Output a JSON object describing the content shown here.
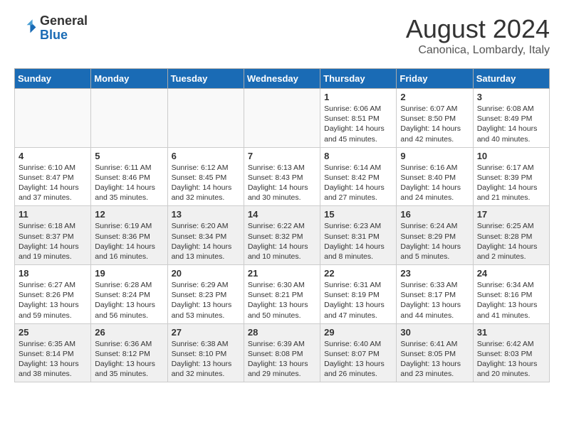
{
  "header": {
    "logo_line1": "General",
    "logo_line2": "Blue",
    "month": "August 2024",
    "location": "Canonica, Lombardy, Italy"
  },
  "weekdays": [
    "Sunday",
    "Monday",
    "Tuesday",
    "Wednesday",
    "Thursday",
    "Friday",
    "Saturday"
  ],
  "weeks": [
    [
      {
        "day": "",
        "empty": true
      },
      {
        "day": "",
        "empty": true
      },
      {
        "day": "",
        "empty": true
      },
      {
        "day": "",
        "empty": true
      },
      {
        "day": "1",
        "lines": [
          "Sunrise: 6:06 AM",
          "Sunset: 8:51 PM",
          "Daylight: 14 hours",
          "and 45 minutes."
        ]
      },
      {
        "day": "2",
        "lines": [
          "Sunrise: 6:07 AM",
          "Sunset: 8:50 PM",
          "Daylight: 14 hours",
          "and 42 minutes."
        ]
      },
      {
        "day": "3",
        "lines": [
          "Sunrise: 6:08 AM",
          "Sunset: 8:49 PM",
          "Daylight: 14 hours",
          "and 40 minutes."
        ]
      }
    ],
    [
      {
        "day": "4",
        "lines": [
          "Sunrise: 6:10 AM",
          "Sunset: 8:47 PM",
          "Daylight: 14 hours",
          "and 37 minutes."
        ]
      },
      {
        "day": "5",
        "lines": [
          "Sunrise: 6:11 AM",
          "Sunset: 8:46 PM",
          "Daylight: 14 hours",
          "and 35 minutes."
        ]
      },
      {
        "day": "6",
        "lines": [
          "Sunrise: 6:12 AM",
          "Sunset: 8:45 PM",
          "Daylight: 14 hours",
          "and 32 minutes."
        ]
      },
      {
        "day": "7",
        "lines": [
          "Sunrise: 6:13 AM",
          "Sunset: 8:43 PM",
          "Daylight: 14 hours",
          "and 30 minutes."
        ]
      },
      {
        "day": "8",
        "lines": [
          "Sunrise: 6:14 AM",
          "Sunset: 8:42 PM",
          "Daylight: 14 hours",
          "and 27 minutes."
        ]
      },
      {
        "day": "9",
        "lines": [
          "Sunrise: 6:16 AM",
          "Sunset: 8:40 PM",
          "Daylight: 14 hours",
          "and 24 minutes."
        ]
      },
      {
        "day": "10",
        "lines": [
          "Sunrise: 6:17 AM",
          "Sunset: 8:39 PM",
          "Daylight: 14 hours",
          "and 21 minutes."
        ]
      }
    ],
    [
      {
        "day": "11",
        "lines": [
          "Sunrise: 6:18 AM",
          "Sunset: 8:37 PM",
          "Daylight: 14 hours",
          "and 19 minutes."
        ]
      },
      {
        "day": "12",
        "lines": [
          "Sunrise: 6:19 AM",
          "Sunset: 8:36 PM",
          "Daylight: 14 hours",
          "and 16 minutes."
        ]
      },
      {
        "day": "13",
        "lines": [
          "Sunrise: 6:20 AM",
          "Sunset: 8:34 PM",
          "Daylight: 14 hours",
          "and 13 minutes."
        ]
      },
      {
        "day": "14",
        "lines": [
          "Sunrise: 6:22 AM",
          "Sunset: 8:32 PM",
          "Daylight: 14 hours",
          "and 10 minutes."
        ]
      },
      {
        "day": "15",
        "lines": [
          "Sunrise: 6:23 AM",
          "Sunset: 8:31 PM",
          "Daylight: 14 hours",
          "and 8 minutes."
        ]
      },
      {
        "day": "16",
        "lines": [
          "Sunrise: 6:24 AM",
          "Sunset: 8:29 PM",
          "Daylight: 14 hours",
          "and 5 minutes."
        ]
      },
      {
        "day": "17",
        "lines": [
          "Sunrise: 6:25 AM",
          "Sunset: 8:28 PM",
          "Daylight: 14 hours",
          "and 2 minutes."
        ]
      }
    ],
    [
      {
        "day": "18",
        "lines": [
          "Sunrise: 6:27 AM",
          "Sunset: 8:26 PM",
          "Daylight: 13 hours",
          "and 59 minutes."
        ]
      },
      {
        "day": "19",
        "lines": [
          "Sunrise: 6:28 AM",
          "Sunset: 8:24 PM",
          "Daylight: 13 hours",
          "and 56 minutes."
        ]
      },
      {
        "day": "20",
        "lines": [
          "Sunrise: 6:29 AM",
          "Sunset: 8:23 PM",
          "Daylight: 13 hours",
          "and 53 minutes."
        ]
      },
      {
        "day": "21",
        "lines": [
          "Sunrise: 6:30 AM",
          "Sunset: 8:21 PM",
          "Daylight: 13 hours",
          "and 50 minutes."
        ]
      },
      {
        "day": "22",
        "lines": [
          "Sunrise: 6:31 AM",
          "Sunset: 8:19 PM",
          "Daylight: 13 hours",
          "and 47 minutes."
        ]
      },
      {
        "day": "23",
        "lines": [
          "Sunrise: 6:33 AM",
          "Sunset: 8:17 PM",
          "Daylight: 13 hours",
          "and 44 minutes."
        ]
      },
      {
        "day": "24",
        "lines": [
          "Sunrise: 6:34 AM",
          "Sunset: 8:16 PM",
          "Daylight: 13 hours",
          "and 41 minutes."
        ]
      }
    ],
    [
      {
        "day": "25",
        "lines": [
          "Sunrise: 6:35 AM",
          "Sunset: 8:14 PM",
          "Daylight: 13 hours",
          "and 38 minutes."
        ]
      },
      {
        "day": "26",
        "lines": [
          "Sunrise: 6:36 AM",
          "Sunset: 8:12 PM",
          "Daylight: 13 hours",
          "and 35 minutes."
        ]
      },
      {
        "day": "27",
        "lines": [
          "Sunrise: 6:38 AM",
          "Sunset: 8:10 PM",
          "Daylight: 13 hours",
          "and 32 minutes."
        ]
      },
      {
        "day": "28",
        "lines": [
          "Sunrise: 6:39 AM",
          "Sunset: 8:08 PM",
          "Daylight: 13 hours",
          "and 29 minutes."
        ]
      },
      {
        "day": "29",
        "lines": [
          "Sunrise: 6:40 AM",
          "Sunset: 8:07 PM",
          "Daylight: 13 hours",
          "and 26 minutes."
        ]
      },
      {
        "day": "30",
        "lines": [
          "Sunrise: 6:41 AM",
          "Sunset: 8:05 PM",
          "Daylight: 13 hours",
          "and 23 minutes."
        ]
      },
      {
        "day": "31",
        "lines": [
          "Sunrise: 6:42 AM",
          "Sunset: 8:03 PM",
          "Daylight: 13 hours",
          "and 20 minutes."
        ]
      }
    ]
  ]
}
